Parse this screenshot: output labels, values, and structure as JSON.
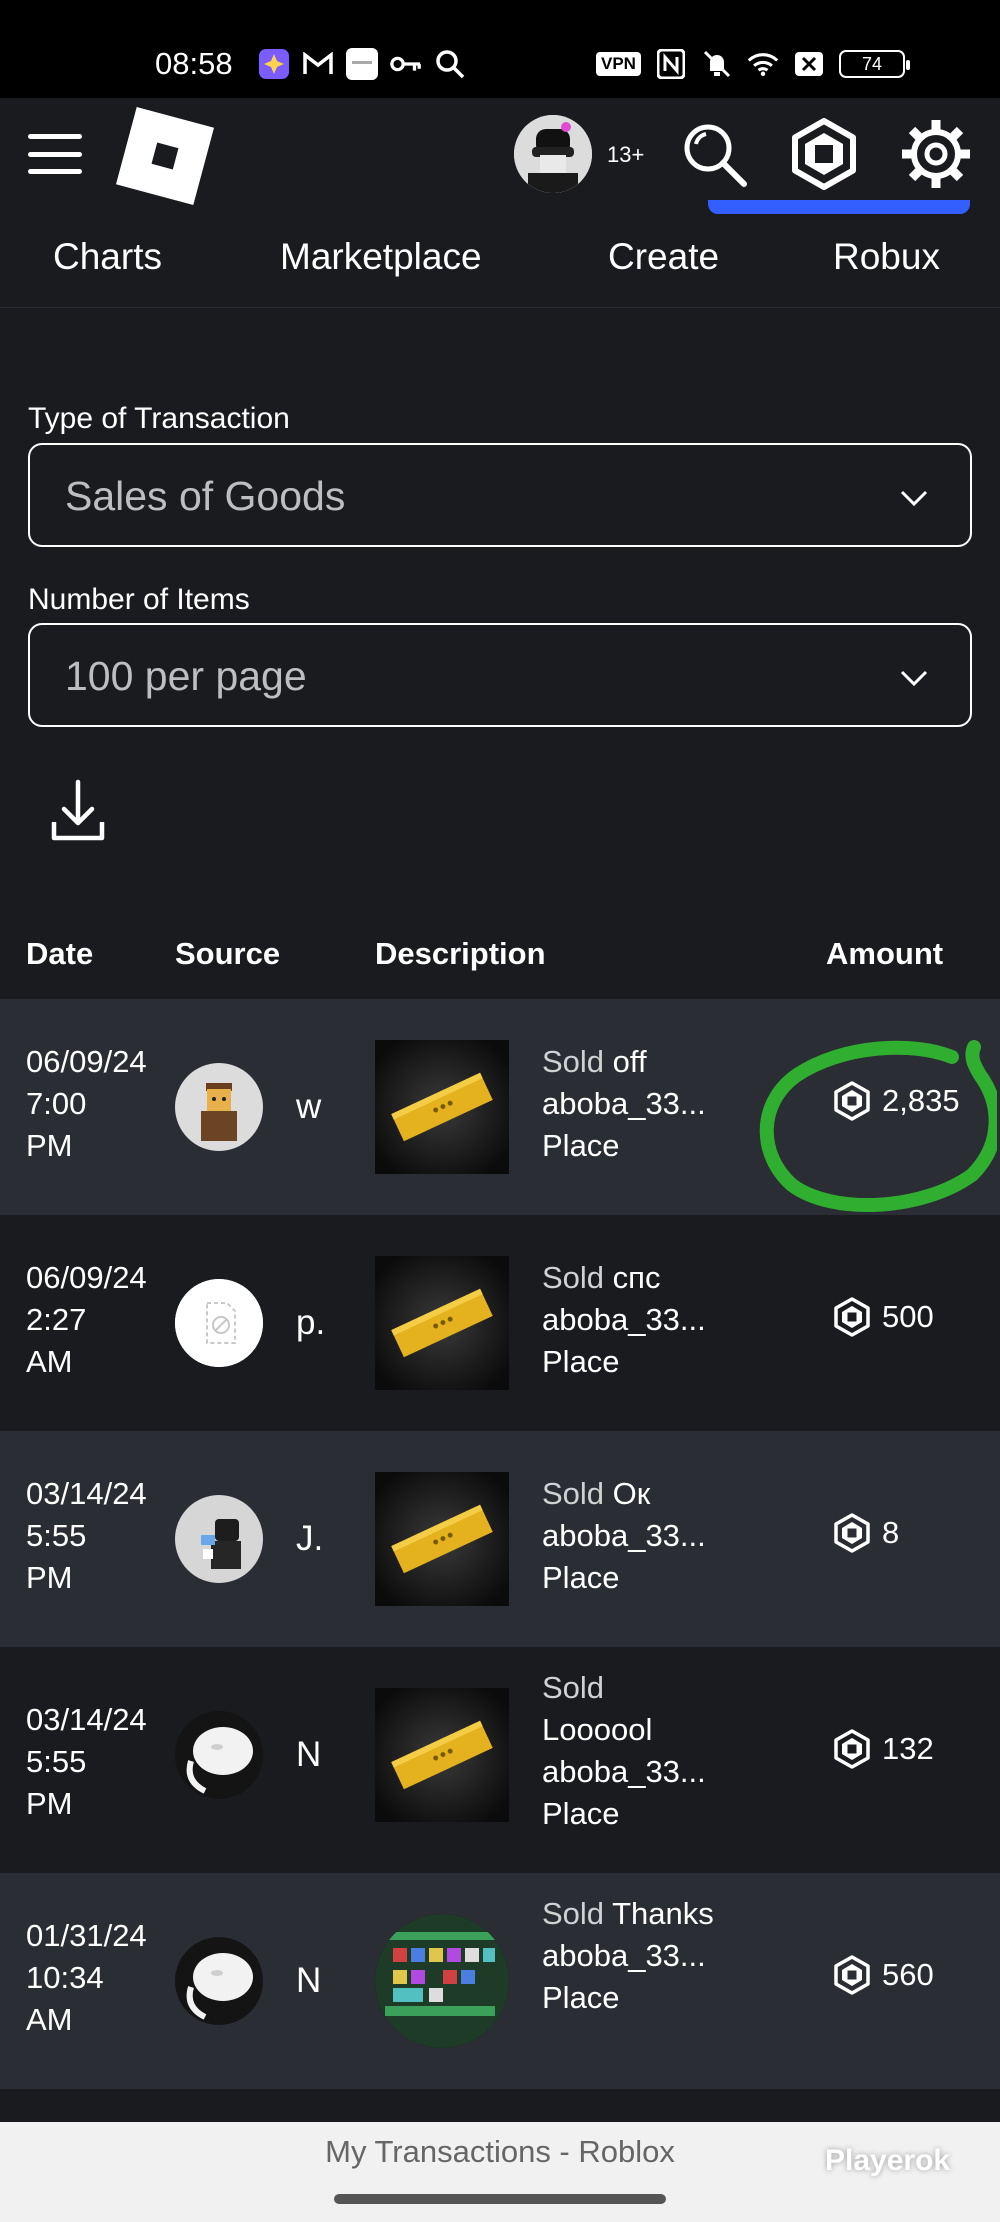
{
  "status_bar": {
    "time": "08:58",
    "vpn_label": "VPN",
    "battery": "74",
    "icons": [
      "app-icon",
      "gmail-icon",
      "notification-icon",
      "key-icon",
      "search-icon",
      "nfc-icon",
      "mute-icon",
      "wifi-icon",
      "no-sim-icon"
    ]
  },
  "header": {
    "age_label": "13+",
    "tabs": [
      {
        "label": "Charts"
      },
      {
        "label": "Marketplace"
      },
      {
        "label": "Create"
      },
      {
        "label": "Robux"
      }
    ],
    "active_tab": "Robux",
    "accent_color": "#335fff"
  },
  "filters": {
    "type_label": "Type of Transaction",
    "type_value": "Sales of Goods",
    "items_label": "Number of Items",
    "items_value": "100 per page"
  },
  "table": {
    "headers": {
      "date": "Date",
      "source": "Source",
      "description": "Description",
      "amount": "Amount"
    },
    "rows": [
      {
        "date": "06/09/24",
        "time": "7:00",
        "ampm": "PM",
        "source": "w",
        "sold": "Sold",
        "item": "off",
        "place": "aboba_33...",
        "place_type": "Place",
        "amount": "2,835"
      },
      {
        "date": "06/09/24",
        "time": "2:27",
        "ampm": "AM",
        "source": "p.",
        "sold": "Sold",
        "item": "спс",
        "place": "aboba_33...",
        "place_type": "Place",
        "amount": "500"
      },
      {
        "date": "03/14/24",
        "time": "5:55",
        "ampm": "PM",
        "source": "J.",
        "sold": "Sold",
        "item": "Ок",
        "place": "aboba_33...",
        "place_type": "Place",
        "amount": "8"
      },
      {
        "date": "03/14/24",
        "time": "5:55",
        "ampm": "PM",
        "source": "N",
        "sold": "Sold",
        "item": "Loooool",
        "place": "aboba_33...",
        "place_type": "Place",
        "amount": "132"
      },
      {
        "date": "01/31/24",
        "time": "10:34",
        "ampm": "AM",
        "source": "N",
        "sold": "Sold",
        "item": "Thanks",
        "place": "aboba_33...",
        "place_type": "Place",
        "amount": "560"
      }
    ]
  },
  "bottom": {
    "page_title": "My Transactions - Roblox",
    "watermark": "Playerok"
  },
  "highlight_color": "#2fb52f"
}
